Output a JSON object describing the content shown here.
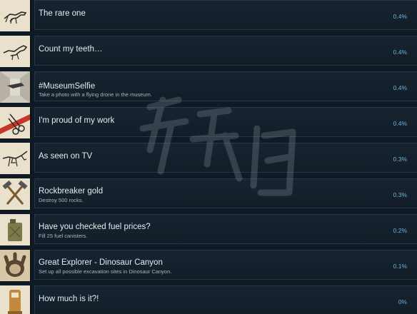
{
  "achievements": [
    {
      "icon": "dinosaur-skeleton-icon",
      "title": "The rare one",
      "description": "",
      "percent": "0.4%"
    },
    {
      "icon": "dinosaur-skeleton-icon",
      "title": "Count my teeth…",
      "description": "",
      "percent": "0.4%"
    },
    {
      "icon": "museum-drone-icon",
      "title": "#MuseumSelfie",
      "description": "Take a photo with a flying drone in the museum.",
      "percent": "0.4%"
    },
    {
      "icon": "ribbon-scissors-icon",
      "title": "I'm proud of my work",
      "description": "",
      "percent": "0.4%"
    },
    {
      "icon": "dinosaur-skeleton-icon",
      "title": "As seen on TV",
      "description": "",
      "percent": "0.3%"
    },
    {
      "icon": "crossed-hammers-icon",
      "title": "Rockbreaker gold",
      "description": "Destroy 500 rocks.",
      "percent": "0.3%"
    },
    {
      "icon": "fuel-canister-icon",
      "title": "Have you checked fuel prices?",
      "description": "Fill 25 fuel canisters.",
      "percent": "0.2%"
    },
    {
      "icon": "footprint-icon",
      "title": "Great Explorer - Dinosaur Canyon",
      "description": "Set up all possible excavation sites in Dinosaur Canyon.",
      "percent": "0.1%"
    },
    {
      "icon": "fuel-pump-icon",
      "title": "How much is it?!",
      "description": "",
      "percent": "0%"
    }
  ],
  "watermark": {
    "text": "游侠网"
  },
  "colors": {
    "background": "#101a24",
    "card": "#172431",
    "percent": "#6fb0d9",
    "thumb": "#e7dfc9"
  }
}
